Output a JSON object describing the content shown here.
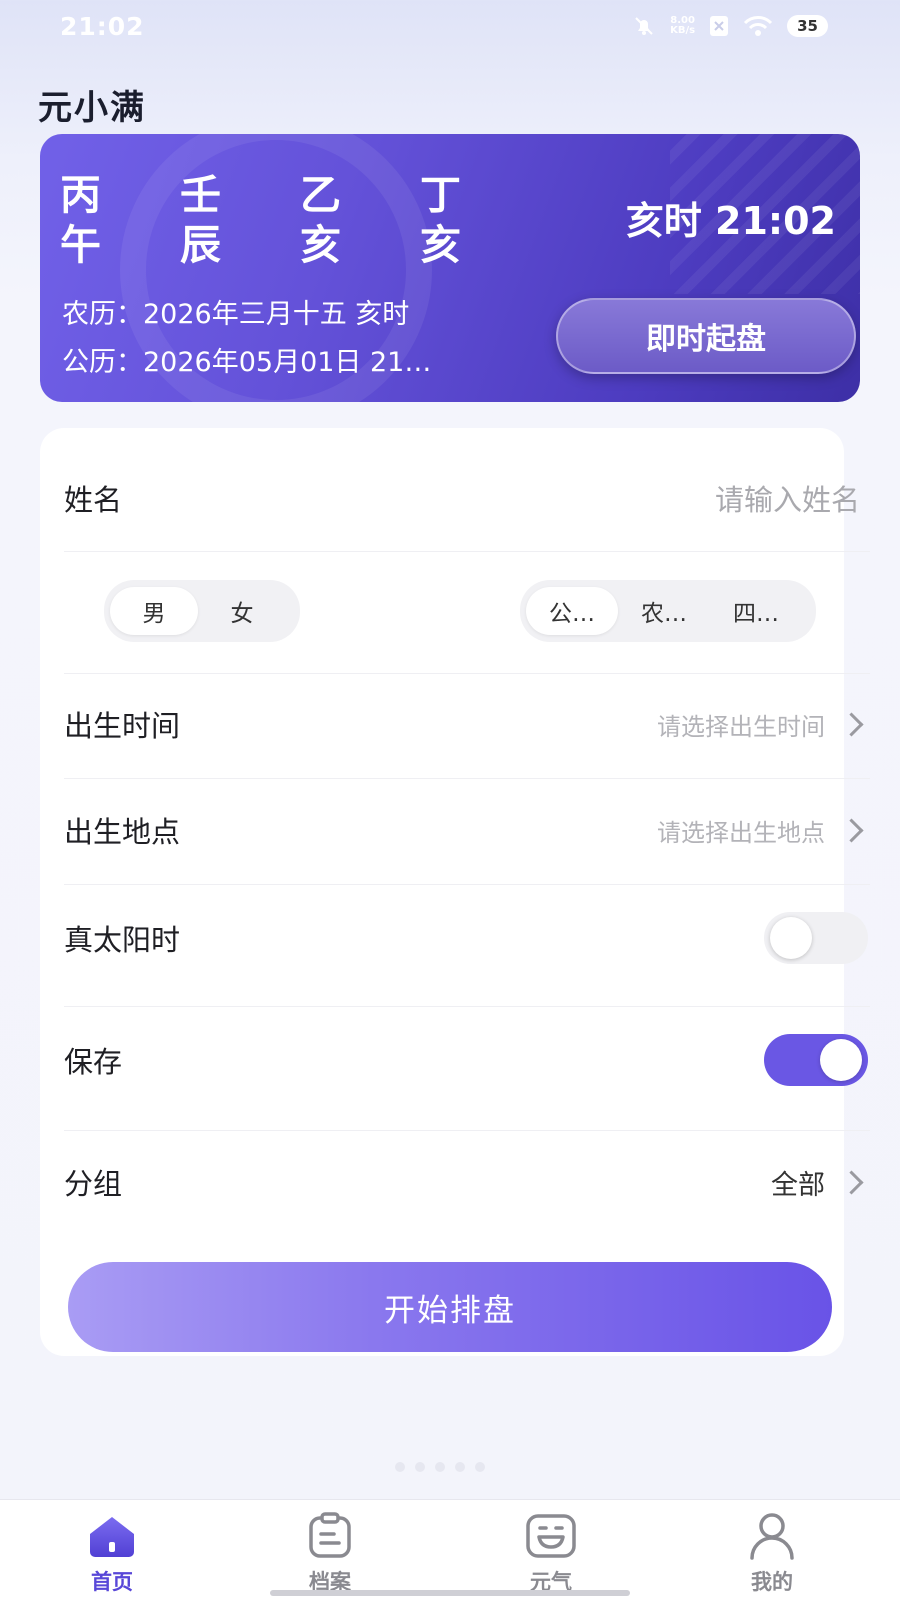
{
  "status_bar": {
    "time": "21:02",
    "net_speed_value": "8.00",
    "net_speed_unit": "KB/s",
    "battery": "35"
  },
  "app": {
    "title": "元小满"
  },
  "banner": {
    "stems": [
      "丙",
      "壬",
      "乙",
      "丁"
    ],
    "branches": [
      "午",
      "辰",
      "亥",
      "亥"
    ],
    "hour_label": "亥时 21:02",
    "lunar_date": "农历：2026年三月十五 亥时",
    "solar_date": "公历：2026年05月01日 21…",
    "instant_button": "即时起盘"
  },
  "form": {
    "name_label": "姓名",
    "name_placeholder": "请输入姓名",
    "gender_options": [
      "男",
      "女"
    ],
    "gender_selected": "男",
    "calendar_options": [
      "公…",
      "农…",
      "四…"
    ],
    "calendar_selected": "公…",
    "birth_time_label": "出生时间",
    "birth_time_placeholder": "请选择出生时间",
    "birth_place_label": "出生地点",
    "birth_place_placeholder": "请选择出生地点",
    "solar_time_label": "真太阳时",
    "solar_time_on": false,
    "save_label": "保存",
    "save_on": true,
    "group_label": "分组",
    "group_value": "全部",
    "start_button": "开始排盘"
  },
  "tabbar": {
    "items": [
      {
        "label": "首页",
        "icon": "home-icon",
        "active": true
      },
      {
        "label": "档案",
        "icon": "clipboard-icon",
        "active": false
      },
      {
        "label": "元气",
        "icon": "smile-face-icon",
        "active": false
      },
      {
        "label": "我的",
        "icon": "user-icon",
        "active": false
      }
    ]
  },
  "colors": {
    "accent": "#6a57e4",
    "banner_start": "#7161e8",
    "banner_end": "#3d2fa6",
    "tab_active": "#5847d8"
  }
}
